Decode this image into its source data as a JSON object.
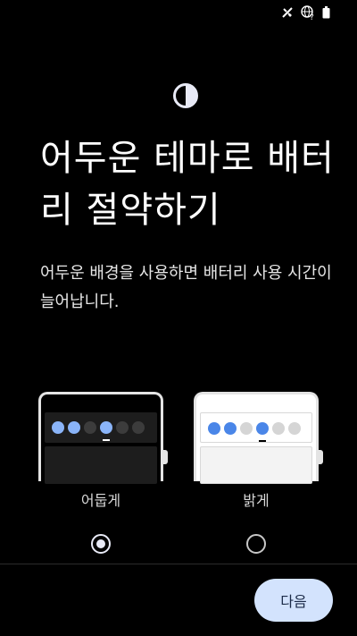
{
  "status_bar": {
    "icons": [
      "data-saver-off-icon",
      "globe-question-icon",
      "battery-icon"
    ]
  },
  "header": {
    "icon": "half-contrast-icon",
    "title": "어두운 테마로 배터리 절약하기",
    "description": "어두운 배경을 사용하면 배터리 사용 시간이 늘어납니다."
  },
  "options": {
    "dark": {
      "label": "어둡게",
      "selected": true
    },
    "light": {
      "label": "밝게",
      "selected": false
    }
  },
  "footer": {
    "next_label": "다음"
  },
  "colors": {
    "background": "#000000",
    "accent": "#d3e3fd",
    "dot_dark_accent": "#8ab4f8",
    "dot_light_accent": "#4a86e8"
  }
}
